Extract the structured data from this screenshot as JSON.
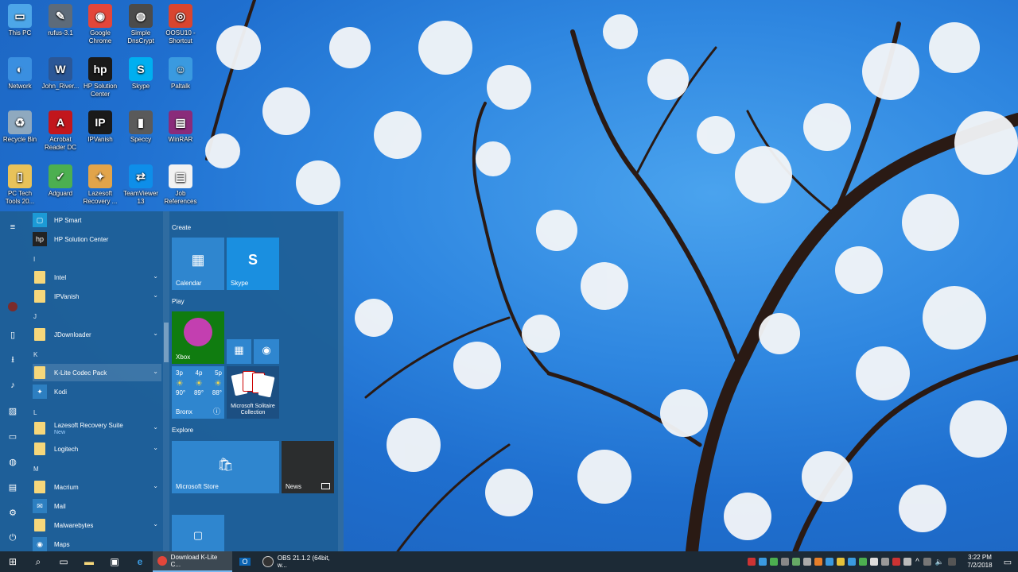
{
  "desktop": {
    "icons": [
      {
        "label": "This PC",
        "glyph": "▭",
        "color": "#4da6e8"
      },
      {
        "label": "rufus-3.1",
        "glyph": "✎",
        "color": "#5d6b7a"
      },
      {
        "label": "Google Chrome",
        "glyph": "◉",
        "color": "#e3463a"
      },
      {
        "label": "Simple DnsCrypt",
        "glyph": "◍",
        "color": "#4b4b4b"
      },
      {
        "label": "OOSU10 - Shortcut",
        "glyph": "◎",
        "color": "#d9452f"
      },
      {
        "label": "Network",
        "glyph": "◐",
        "color": "#3a8fe0"
      },
      {
        "label": "John_River...",
        "glyph": "W",
        "color": "#2b5797"
      },
      {
        "label": "HP Solution Center",
        "glyph": "hp",
        "color": "#1a1a1a"
      },
      {
        "label": "Skype",
        "glyph": "S",
        "color": "#00aff0"
      },
      {
        "label": "Paltalk",
        "glyph": "☺",
        "color": "#3a9ae0"
      },
      {
        "label": "Recycle Bin",
        "glyph": "♻",
        "color": "#8fa9bf"
      },
      {
        "label": "Acrobat Reader DC",
        "glyph": "A",
        "color": "#c2161c"
      },
      {
        "label": "IPVanish",
        "glyph": "IP",
        "color": "#1a1a1a"
      },
      {
        "label": "Speccy",
        "glyph": "▮",
        "color": "#5a5a5a"
      },
      {
        "label": "WinRAR",
        "glyph": "▤",
        "color": "#8a2b7a"
      },
      {
        "label": "PC Tech Tools 20...",
        "glyph": "▯",
        "color": "#e8c25a"
      },
      {
        "label": "Adguard",
        "glyph": "✓",
        "color": "#4caf50"
      },
      {
        "label": "Lazesoft Recovery ...",
        "glyph": "✦",
        "color": "#e2a44a"
      },
      {
        "label": "TeamViewer 13",
        "glyph": "⇄",
        "color": "#0e8ee9"
      },
      {
        "label": "Job References",
        "glyph": "▤",
        "color": "#f2f2f2"
      }
    ]
  },
  "startmenu": {
    "rail": [
      "menu-icon",
      "avatar",
      "documents-icon",
      "downloads-icon",
      "music-icon",
      "pictures-icon",
      "videos-icon",
      "network-icon",
      "file-explorer-icon",
      "settings-icon",
      "power-icon"
    ],
    "rail_glyphs": [
      "≡",
      "●",
      "▯",
      "⭳",
      "♪",
      "▨",
      "▭",
      "◍",
      "▤",
      "⚙",
      "⏻"
    ],
    "applist": [
      {
        "kind": "app",
        "label": "HP Smart",
        "glyph": "▢",
        "color": "#1c9ad6"
      },
      {
        "kind": "app",
        "label": "HP Solution Center",
        "glyph": "hp",
        "color": "#222"
      },
      {
        "kind": "letter",
        "label": "I"
      },
      {
        "kind": "folder",
        "label": "Intel",
        "expand": true
      },
      {
        "kind": "folder",
        "label": "IPVanish",
        "expand": true
      },
      {
        "kind": "letter",
        "label": "J"
      },
      {
        "kind": "folder",
        "label": "JDownloader",
        "expand": true
      },
      {
        "kind": "letter",
        "label": "K"
      },
      {
        "kind": "folder",
        "label": "K-Lite Codec Pack",
        "expand": true,
        "highlight": true
      },
      {
        "kind": "app",
        "label": "Kodi",
        "glyph": "✦",
        "color": "#2d7fc1"
      },
      {
        "kind": "letter",
        "label": "L"
      },
      {
        "kind": "folder",
        "label": "Lazesoft Recovery Suite",
        "expand": true,
        "sub": "New"
      },
      {
        "kind": "folder",
        "label": "Logitech",
        "expand": true
      },
      {
        "kind": "letter",
        "label": "M"
      },
      {
        "kind": "folder",
        "label": "Macrium",
        "expand": true
      },
      {
        "kind": "app",
        "label": "Mail",
        "glyph": "✉",
        "color": "#2d7fc1"
      },
      {
        "kind": "folder",
        "label": "Malwarebytes",
        "expand": true
      },
      {
        "kind": "app",
        "label": "Maps",
        "glyph": "◉",
        "color": "#2d7fc1"
      }
    ],
    "groups": {
      "create": "Create",
      "play": "Play",
      "explore": "Explore"
    },
    "tiles": {
      "calendar": "Calendar",
      "skype": "Skype",
      "xbox": "Xbox",
      "solitaire": "Microsoft Solitaire Collection",
      "store": "Microsoft Store",
      "news": "News",
      "weather": {
        "hours": [
          "3p",
          "4p",
          "5p"
        ],
        "temps": [
          "90°",
          "89°",
          "88°"
        ],
        "location": "Bronx"
      }
    }
  },
  "taskbar": {
    "apps": [
      {
        "label": "Download K-Lite C...",
        "color": "#e3463a",
        "active": true
      },
      {
        "label": "OBS 21.1.2 (64bit, w...",
        "color": "#333",
        "active": false
      }
    ],
    "clock": {
      "time": "3:22 PM",
      "date": "7/2/2018"
    }
  },
  "colors": {
    "accent": "#2c8ad8",
    "xbox": "#107c10",
    "taskbar": "#1c2a36"
  }
}
